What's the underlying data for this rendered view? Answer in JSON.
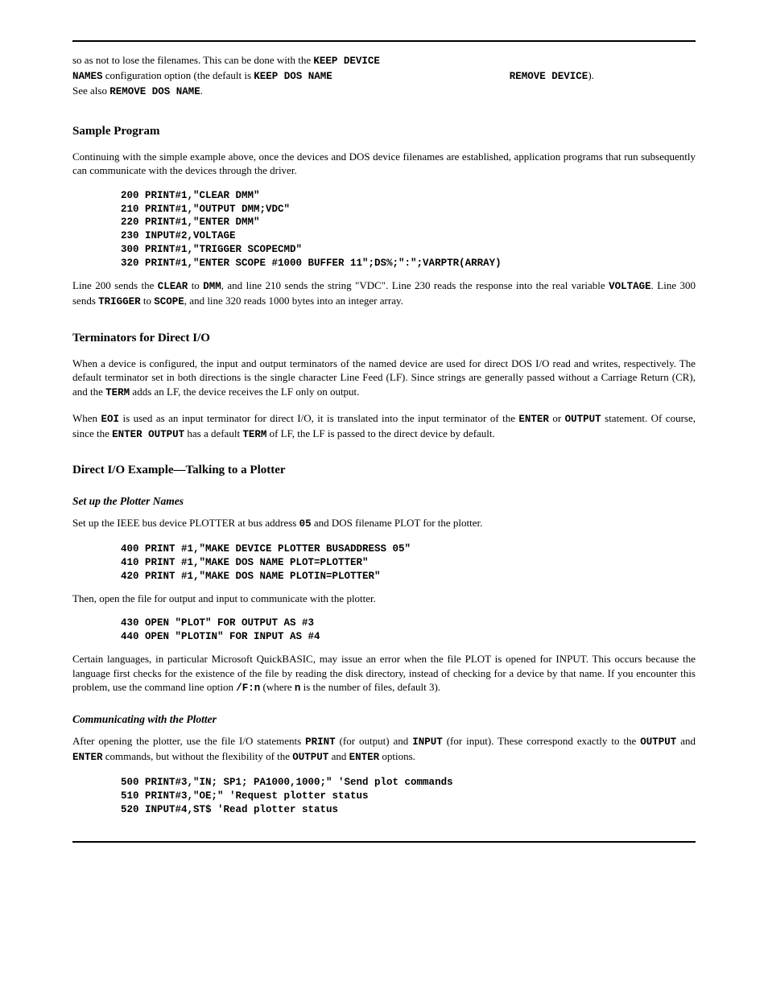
{
  "header": {
    "line1_left": "so as not to lose the filenames. This can be done with the ",
    "line1_right": "KEEP DEVICE",
    "line2_left": "NAMES",
    "line2_mid": " configuration option (the default is ",
    "line2_code": "KEEP DOS NAME",
    "line2_code2": "REMOVE DEVICE",
    "line2_end": ").",
    "line3_left": "See also ",
    "line3_code": "REMOVE DOS NAME",
    "line3_end": "."
  },
  "sec_sample": {
    "title": "Sample Program",
    "para1": "Continuing with the simple example above, once the devices and DOS device filenames are established, application programs that run subsequently can communicate with the devices through the driver.",
    "code1": "200 PRINT#1,\"CLEAR DMM\"\n210 PRINT#1,\"OUTPUT DMM;VDC\"\n220 PRINT#1,\"ENTER DMM\"\n230 INPUT#2,VOLTAGE\n300 PRINT#1,\"TRIGGER SCOPECMD\"\n320 PRINT#1,\"ENTER SCOPE #1000 BUFFER 11\";DS%;\":\";VARPTR(ARRAY)",
    "para2_a": "Line 200 sends the ",
    "para2_code1": "CLEAR",
    "para2_b": " to ",
    "para2_code2": "DMM",
    "para2_c": ", and line 210 sends the string \"VDC\". Line 230 reads the response into the real variable ",
    "para2_code3": "VOLTAGE",
    "para2_d": ". Line 300 sends ",
    "para2_code4": "TRIGGER",
    "para2_e": " to ",
    "para2_code5": "SCOPE",
    "para2_f": ", and line 320 reads 1000 bytes into an integer array."
  },
  "sec_terms": {
    "title": "Terminators for Direct I/O",
    "para1_a": "When a device is configured, the input and output terminators of the named device are used for direct DOS I/O read and writes, respectively. The default terminator set in both directions is the single character Line Feed (LF). Since strings are generally passed without a Carriage Return (CR), and the ",
    "para1_code1": "TERM",
    "para1_b": " adds an LF, the device receives the LF only on output.",
    "para2_a": "When ",
    "para2_code1": "EOI",
    "para2_b": " is used as an input terminator for direct I/O, it is translated into the input terminator of the ",
    "para2_code2": "ENTER",
    "para2_c": " or ",
    "para2_code3": "OUTPUT",
    "para2_d": " statement. Of course, since the ",
    "para2_code4": "ENTER OUTPUT",
    "para2_e": " has a default ",
    "para2_code5": "TERM",
    "para2_f": " of LF, the LF is passed to the direct device by default."
  },
  "sec_plotter": {
    "title": "Direct I/O Example—Talking to a Plotter",
    "subtitle": "Set up the Plotter Names",
    "para1_a": "Set up the IEEE bus device PLOTTER at bus address ",
    "para1_code1": "05",
    "para1_b": " and DOS filename PLOT for the plotter.",
    "code1": "400 PRINT #1,\"MAKE DEVICE PLOTTER BUSADDRESS 05\"\n410 PRINT #1,\"MAKE DOS NAME PLOT=PLOTTER\"\n420 PRINT #1,\"MAKE DOS NAME PLOTIN=PLOTTER\"",
    "para2": "Then, open the file for output and input to communicate with the plotter.",
    "code2": "430 OPEN \"PLOT\" FOR OUTPUT AS #3\n440 OPEN \"PLOTIN\" FOR INPUT AS #4",
    "para3_a": "Certain languages, in particular Microsoft QuickBASIC, may issue an error when the file PLOT is opened for INPUT. This occurs because the language first checks for the existence of the file by reading the disk directory, instead of checking for a device by that name. If you encounter this problem, use the command line option ",
    "para3_code1": "/F:n",
    "para3_b": " (where ",
    "para3_code2": "n",
    "para3_c": " is the number of files, default 3)."
  },
  "sec_plotcomm": {
    "subtitle": "Communicating with the Plotter",
    "para1_a": "After opening the plotter, use the file I/O statements ",
    "para1_code1": "PRINT",
    "para1_b": " (for output) and ",
    "para1_code2": "INPUT",
    "para1_c": " (for input). These correspond exactly to the ",
    "para1_code3": "OUTPUT",
    "para1_d": " and ",
    "para1_code4": "ENTER",
    "para1_e": " commands, but without the flexibility of the ",
    "para1_code5": "OUTPUT",
    "para1_f": " and ",
    "para1_code6": "ENTER",
    "para1_g": " options.",
    "code1": "500 PRINT#3,\"IN; SP1; PA1000,1000;\" 'Send plot commands\n510 PRINT#3,\"OE;\" 'Request plotter status\n520 INPUT#4,ST$ 'Read plotter status"
  }
}
